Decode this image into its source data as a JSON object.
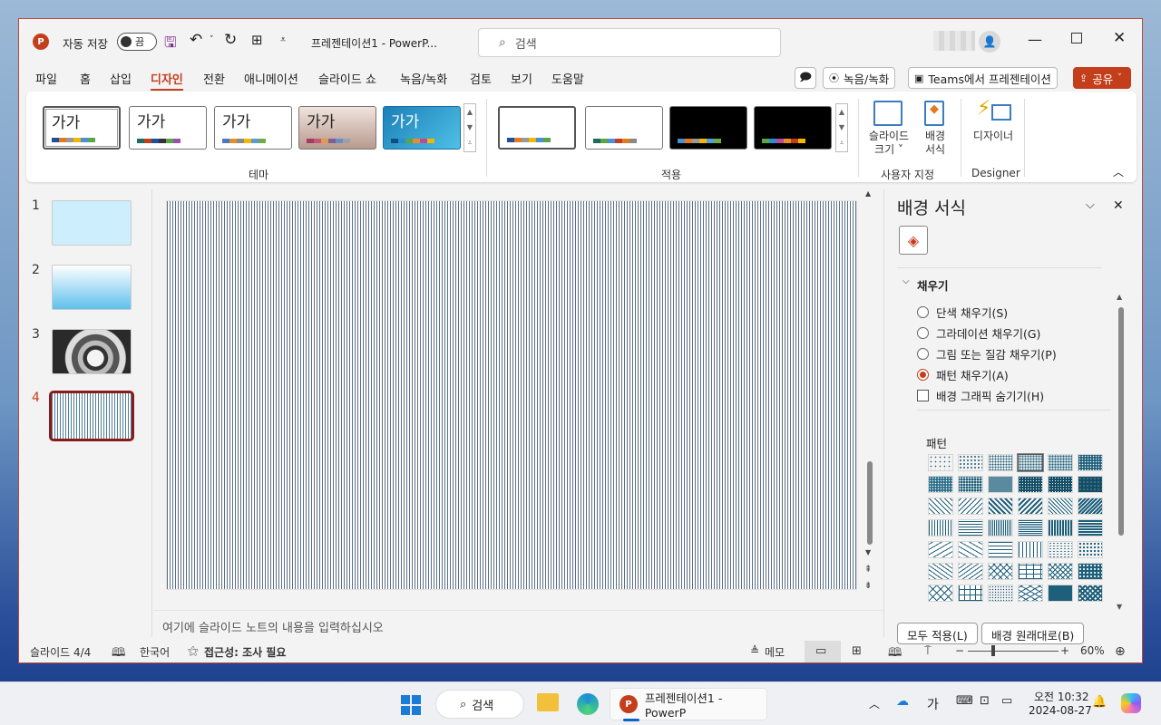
{
  "window": {
    "autosave_label": "자동 저장",
    "autosave_state": "끔",
    "doc_title": "프레젠테이션1  -  PowerP...",
    "search_placeholder": "검색"
  },
  "menu": [
    "파일",
    "홈",
    "삽입",
    "디자인",
    "전환",
    "애니메이션",
    "슬라이드 쇼",
    "녹음/녹화",
    "검토",
    "보기",
    "도움말"
  ],
  "menu_active_index": 3,
  "right_buttons": {
    "record": "녹음/녹화",
    "teams": "Teams에서 프레젠테이션",
    "share": "공유"
  },
  "ribbon": {
    "theme_thumb_text": "가가",
    "themes_group_label": "테마",
    "variants_group_label": "적용",
    "customize_group_label": "사용자 지정",
    "designer_group_label": "Designer",
    "slide_size_label": "슬라이드\n크기",
    "slide_size_line1": "슬라이드",
    "slide_size_line2": "크기 ˅",
    "format_bg_line1": "배경",
    "format_bg_line2": "서식",
    "designer_label": "디자이너"
  },
  "slides": [
    {
      "num": "1"
    },
    {
      "num": "2"
    },
    {
      "num": "3"
    },
    {
      "num": "4"
    }
  ],
  "notes_placeholder": "여기에 슬라이드 노트의 내용을 입력하십시오",
  "pane": {
    "title": "배경 서식",
    "section": "채우기",
    "options": [
      "단색 채우기(S)",
      "그라데이션 채우기(G)",
      "그림 또는 질감 채우기(P)",
      "패턴 채우기(A)"
    ],
    "selected_option": "패턴 채우기(A)",
    "hide_bg_graphics": "배경 그래픽 숨기기(H)",
    "pattern_label": "패턴",
    "apply_all": "모두 적용(L)",
    "reset_bg": "배경 원래대로(B)"
  },
  "status": {
    "slide_count": "슬라이드 4/4",
    "language": "한국어",
    "accessibility": "접근성: 조사 필요",
    "notes_btn": "메모",
    "zoom": "60%"
  },
  "taskbar": {
    "search": "검색",
    "app_label": "프레젠테이션1 - PowerP",
    "ime": "가",
    "time": "오전 10:32",
    "date": "2024-08-27"
  },
  "colors": {
    "accent": "#c43e1c",
    "pattern": "#1e5f7a"
  }
}
